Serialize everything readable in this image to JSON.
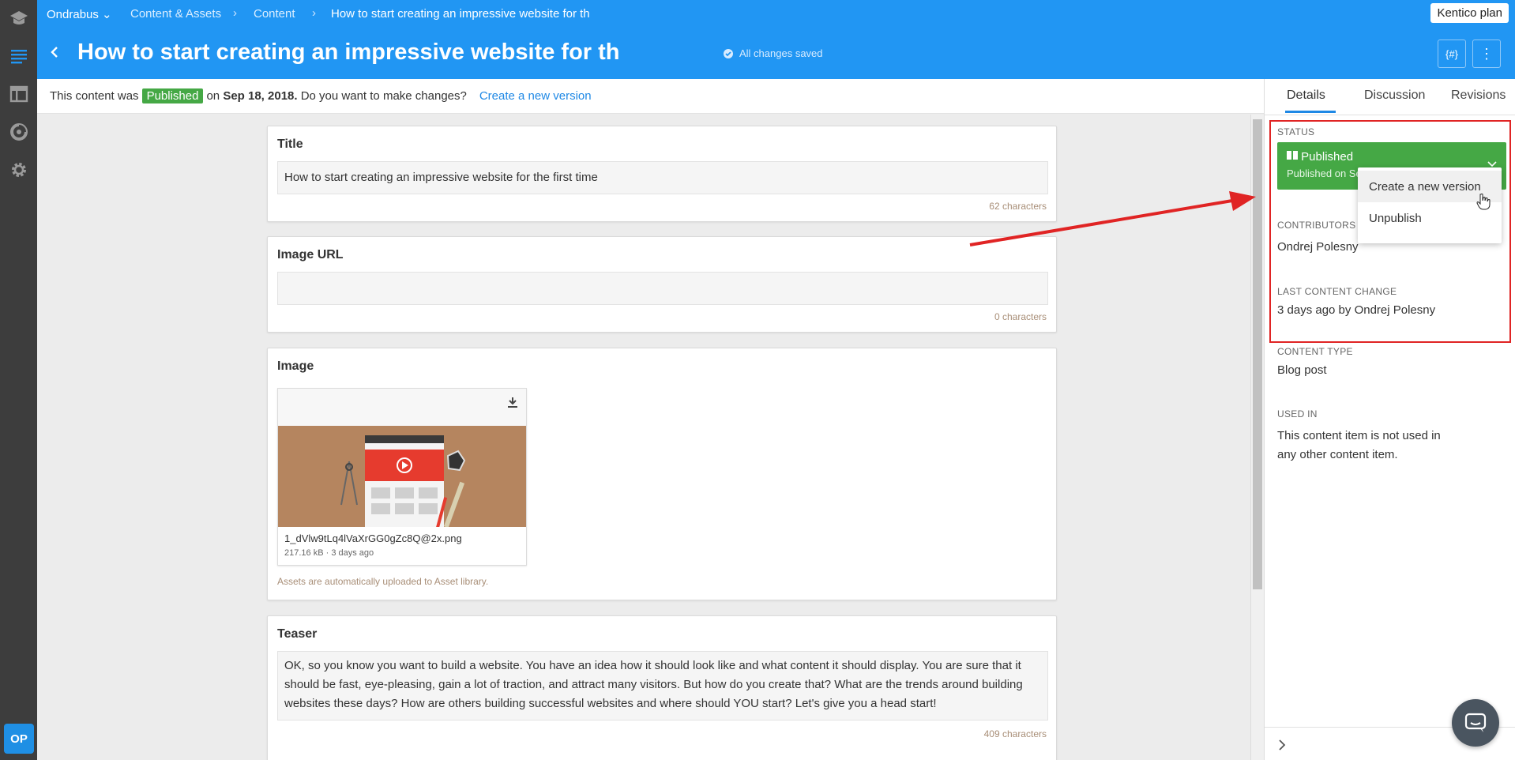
{
  "breadcrumb": {
    "project": "Ondrabus",
    "section": "Content & Assets",
    "sub": "Content",
    "current": "How to start creating an impressive website for th"
  },
  "header": {
    "title": "How to start creating an impressive website for th",
    "saved_status": "All changes saved",
    "plan_button": "Kentico plan",
    "snippet_button": "{#}",
    "more_button": "⋮"
  },
  "notice": {
    "prefix": "This content was",
    "badge": "Published",
    "on": "on",
    "date": "Sep 18, 2018.",
    "question": "Do you want to make changes?",
    "link": "Create a new version"
  },
  "elements": {
    "title": {
      "label": "Title",
      "value": "How to start creating an impressive website for the first time",
      "count": "62 characters"
    },
    "image_url": {
      "label": "Image URL",
      "value": "",
      "count": "0 characters"
    },
    "image": {
      "label": "Image",
      "file_name": "1_dVlw9tLq4lVaXrGG0gZc8Q@2x.png",
      "file_meta": "217.16 kB · 3 days ago",
      "note": "Assets are automatically uploaded to Asset library."
    },
    "teaser": {
      "label": "Teaser",
      "value": "OK, so you know you want to build a website. You have an idea how it should look like and what content it should display. You are sure that it should be fast, eye-pleasing, gain a lot of traction, and attract many visitors. But how do you create that? What are the trends around building websites these days? How are others building successful websites and where should YOU start? Let's give you a head start!",
      "count": "409 characters"
    }
  },
  "panel": {
    "tabs": [
      "Details",
      "Discussion",
      "Revisions"
    ],
    "status_label": "STATUS",
    "status_title": "Published",
    "status_sub": "Published on Se",
    "dropdown": [
      "Create a new version",
      "Unpublish"
    ],
    "contributors_label": "CONTRIBUTORS",
    "contributors_value": "Ondrej Polesny",
    "last_change_label": "LAST CONTENT CHANGE",
    "last_change_value": "3 days ago by Ondrej Polesny",
    "content_type_label": "CONTENT TYPE",
    "content_type_value": "Blog post",
    "used_in_label": "USED IN",
    "used_in_value": "This content item is not used in any other content item."
  },
  "user": {
    "initials": "OP"
  },
  "colors": {
    "brand_blue": "#2196f3",
    "published_green": "#45a845",
    "highlight_red": "#e02424",
    "link_blue": "#1e88e5"
  },
  "icons": [
    "home-icon",
    "content-icon",
    "layout-icon",
    "analytics-icon",
    "gear-icon",
    "back-icon",
    "check-circle-icon",
    "download-icon",
    "chevron-down-icon",
    "chevron-right-icon",
    "chat-icon",
    "hand-cursor-icon"
  ]
}
